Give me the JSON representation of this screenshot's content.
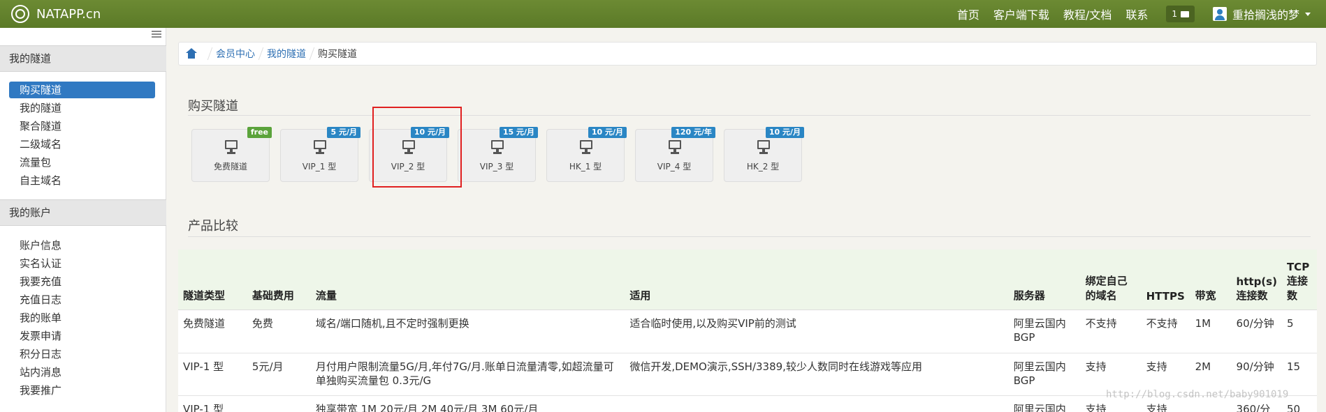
{
  "topbar": {
    "brand": "NATAPP.cn",
    "nav": [
      "首页",
      "客户端下载",
      "教程/文档",
      "联系"
    ],
    "message_count": "1",
    "username": "重拾搁浅的梦"
  },
  "sidebar": {
    "section1": "我的隧道",
    "items1": [
      "购买隧道",
      "我的隧道",
      "聚合隧道",
      "二级域名",
      "流量包",
      "自主域名"
    ],
    "section2": "我的账户",
    "items2": [
      "账户信息",
      "实名认证",
      "我要充值",
      "充值日志",
      "我的账单",
      "发票申请",
      "积分日志",
      "站内消息",
      "我要推广"
    ]
  },
  "breadcrumb": [
    "会员中心",
    "我的隧道",
    "购买隧道"
  ],
  "buy_title": "购买隧道",
  "plans": [
    {
      "name": "免费隧道",
      "badge": "free"
    },
    {
      "name": "VIP_1 型",
      "badge": "5 元/月"
    },
    {
      "name": "VIP_2 型",
      "badge": "10 元/月"
    },
    {
      "name": "VIP_3 型",
      "badge": "15 元/月"
    },
    {
      "name": "HK_1 型",
      "badge": "10 元/月"
    },
    {
      "name": "VIP_4 型",
      "badge": "120 元/年"
    },
    {
      "name": "HK_2 型",
      "badge": "10 元/月"
    }
  ],
  "compare_title": "产品比较",
  "table": {
    "headers": [
      "隧道类型",
      "基础费用",
      "流量",
      "适用",
      "服务器",
      "绑定自己的域名",
      "HTTPS",
      "带宽",
      "http(s)连接数",
      "TCP连接数"
    ],
    "rows": [
      [
        "免费隧道",
        "免费",
        "域名/端口随机,且不定时强制更换",
        "适合临时使用,以及购买VIP前的测试",
        "阿里云国内BGP",
        "不支持",
        "不支持",
        "1M",
        "60/分钟",
        "5"
      ],
      [
        "VIP-1 型",
        "5元/月",
        "月付用户限制流量5G/月,年付7G/月.账单日流量清零,如超流量可单独购买流量包 0.3元/G",
        "微信开发,DEMO演示,SSH/3389,较少人数同时在线游戏等应用",
        "阿里云国内BGP",
        "支持",
        "支持",
        "2M",
        "90/分钟",
        "15"
      ],
      [
        "VIP-1 型",
        "",
        "独享带宽 1M 20元/月 2M 40元/月 3M 60元/月",
        "",
        "阿里云国内",
        "支持",
        "支持",
        "",
        "360/分",
        "50"
      ]
    ]
  },
  "watermark": "http://blog.csdn.net/baby901019"
}
